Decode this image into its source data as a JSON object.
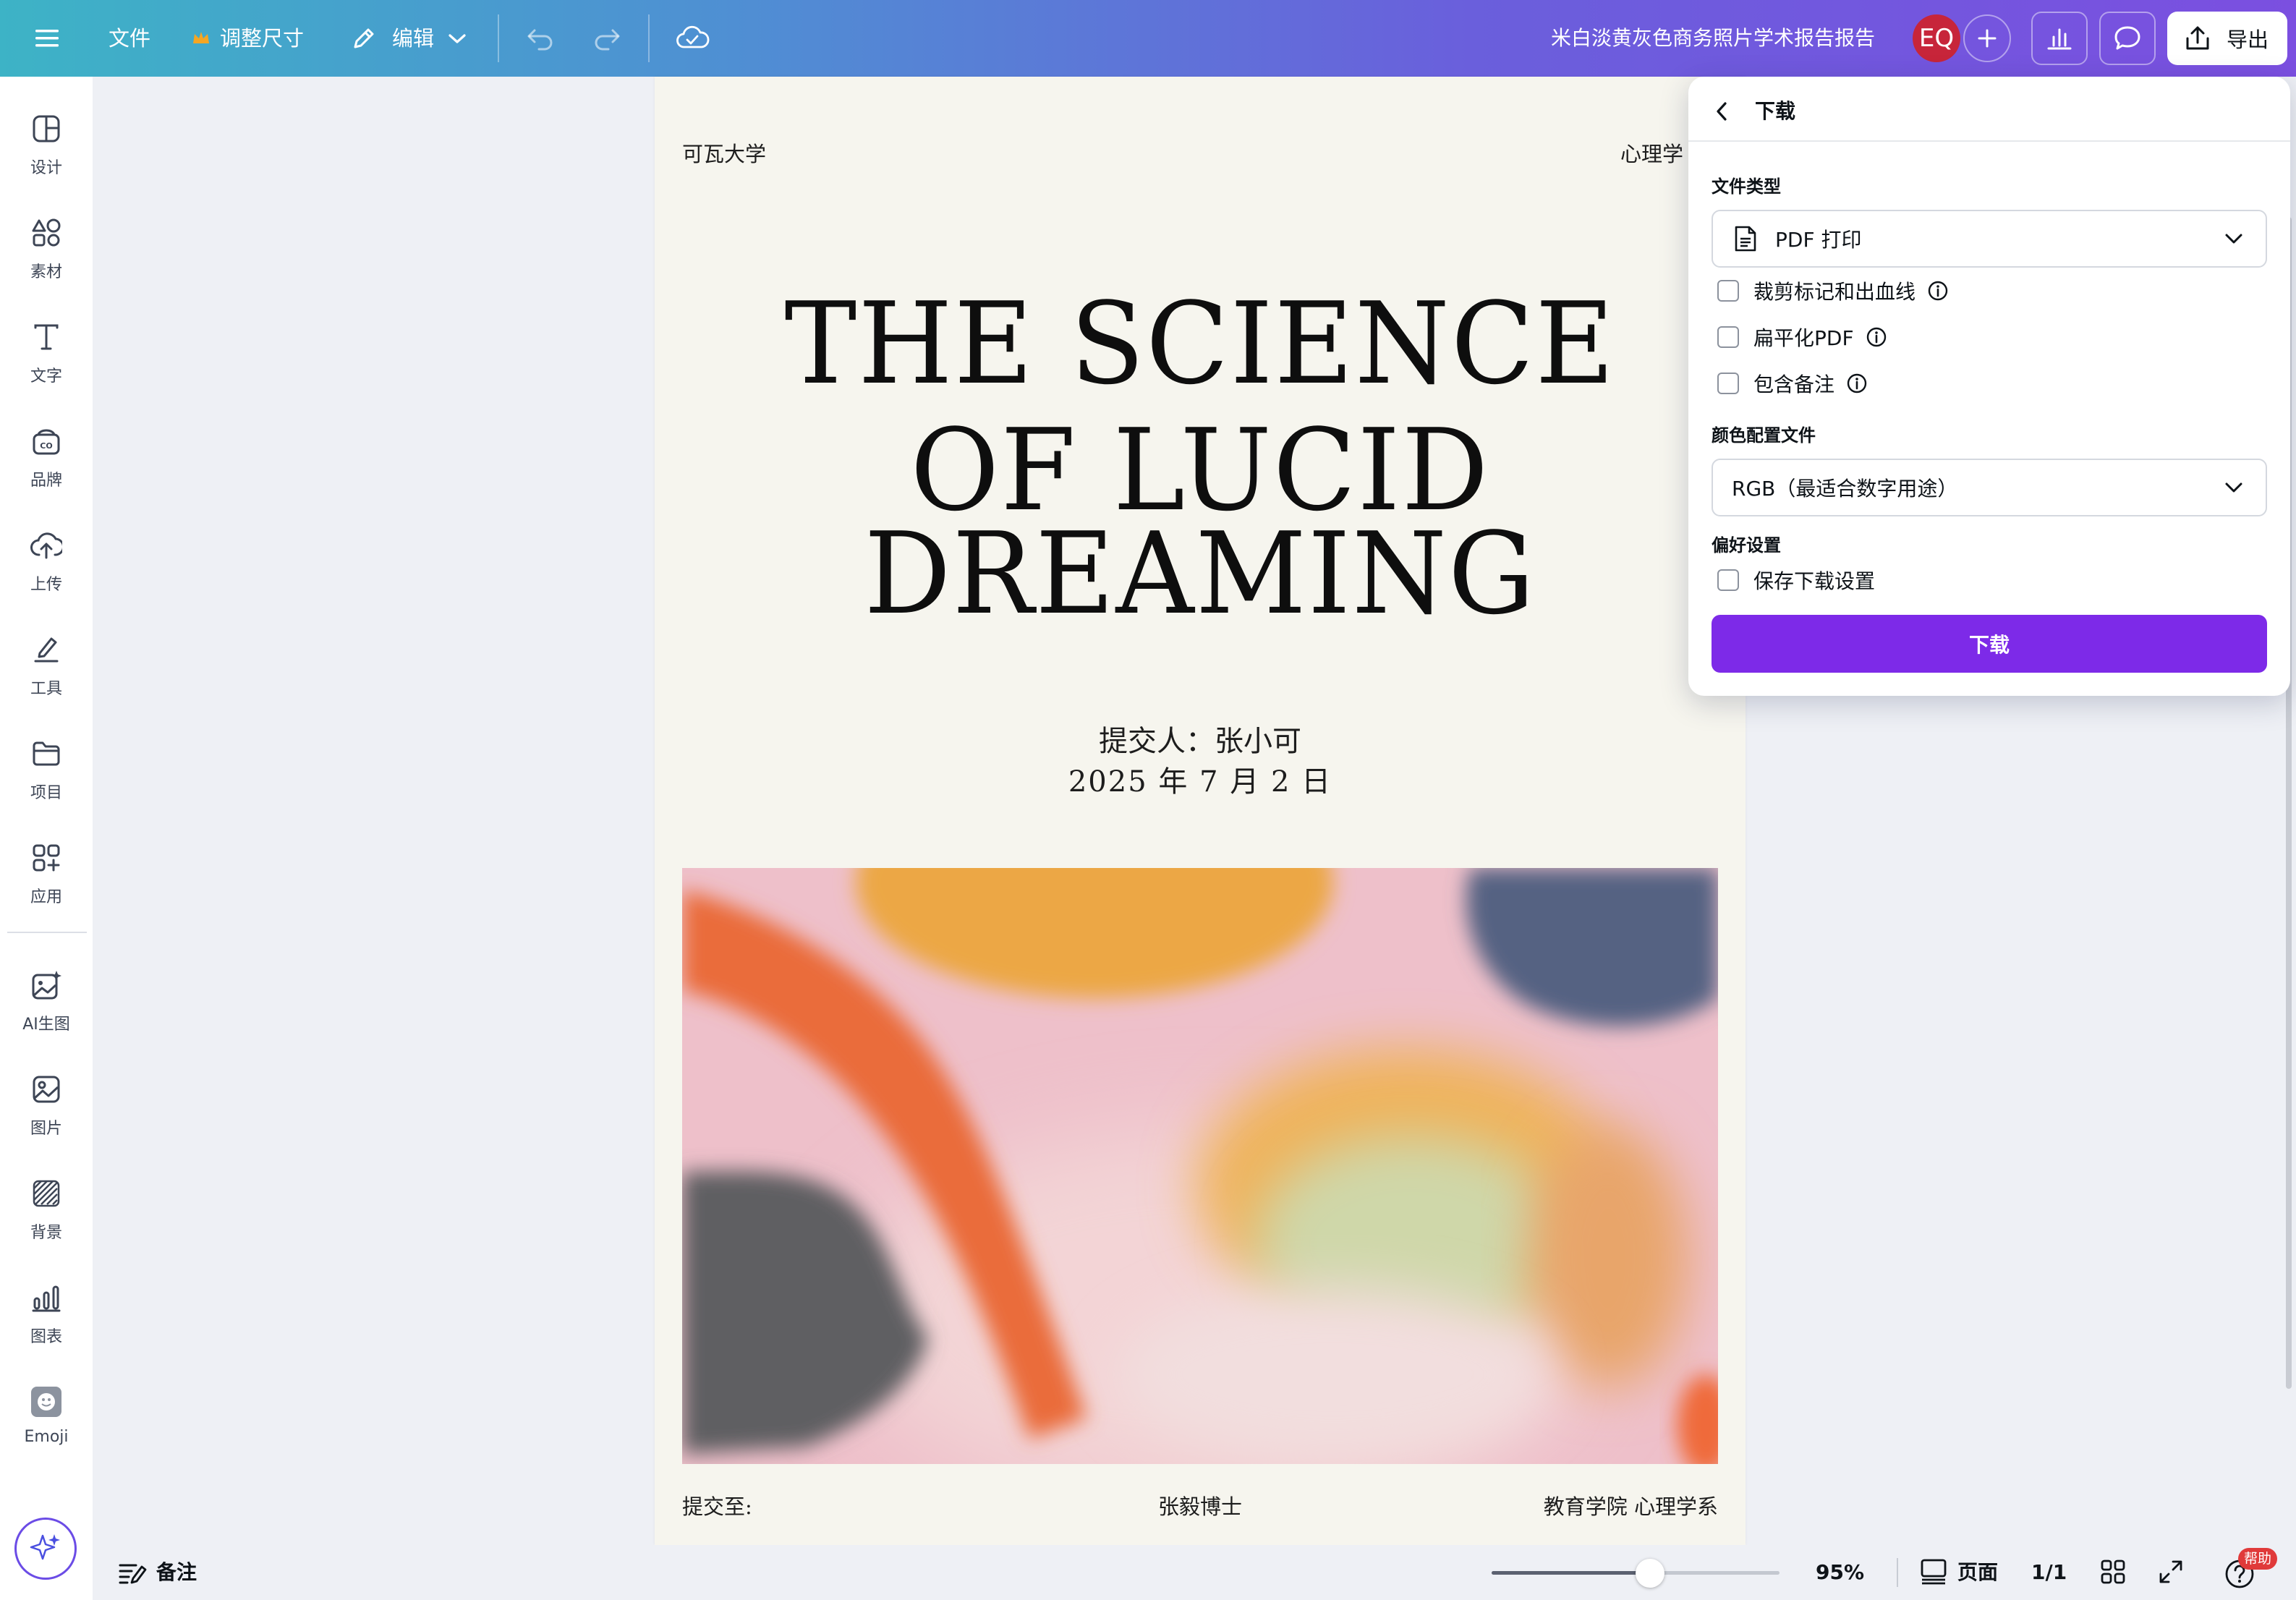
{
  "topbar": {
    "menu_label": "文件",
    "resize_label": "调整尺寸",
    "edit_label": "编辑",
    "doc_title": "米白淡黄灰色商务照片学术报告报告",
    "avatar": "EQ",
    "export_label": "导出"
  },
  "sidebar": {
    "items": [
      {
        "label": "设计",
        "icon": "design-icon"
      },
      {
        "label": "素材",
        "icon": "elements-icon"
      },
      {
        "label": "文字",
        "icon": "text-icon"
      },
      {
        "label": "品牌",
        "icon": "brand-icon"
      },
      {
        "label": "上传",
        "icon": "upload-icon"
      },
      {
        "label": "工具",
        "icon": "draw-tool-icon"
      },
      {
        "label": "项目",
        "icon": "folder-icon"
      },
      {
        "label": "应用",
        "icon": "apps-icon"
      },
      {
        "label": "AI生图",
        "icon": "ai-image-icon"
      },
      {
        "label": "图片",
        "icon": "photo-icon"
      },
      {
        "label": "背景",
        "icon": "background-icon"
      },
      {
        "label": "图表",
        "icon": "chart-icon"
      },
      {
        "label": "Emoji",
        "icon": "emoji-icon"
      }
    ]
  },
  "document": {
    "university": "可瓦大学",
    "department_top": "心理学",
    "title_line1": "THE SCIENCE",
    "title_line2": "OF LUCID",
    "title_line3": "DREAMING",
    "submitter": "提交人：张小可",
    "date": "2025 年 7 月 2 日",
    "footer_left": "提交至:",
    "footer_center": "张毅博士",
    "footer_right": "教育学院 心理学系"
  },
  "download_panel": {
    "title": "下载",
    "file_type_label": "文件类型",
    "file_type_value": "PDF 打印",
    "options": [
      {
        "label": "裁剪标记和出血线",
        "checked": false,
        "info": true
      },
      {
        "label": "扁平化PDF",
        "checked": false,
        "info": true
      },
      {
        "label": "包含备注",
        "checked": false,
        "info": true
      }
    ],
    "color_profile_label": "颜色配置文件",
    "color_profile_value": "RGB（最适合数字用途）",
    "preferences_label": "偏好设置",
    "save_settings_label": "保存下载设置",
    "download_button": "下载",
    "accent": "#7d2ae8"
  },
  "bottombar": {
    "notes_label": "备注",
    "zoom_level": "95%",
    "zoom_fraction": 0.55,
    "pages_label": "页面",
    "page_indicator": "1/1",
    "help_label": "帮助"
  },
  "colors": {
    "page_bg": "#f6f5ee",
    "rail_bg": "#ffffff",
    "workspace_bg": "#eef0f5"
  }
}
